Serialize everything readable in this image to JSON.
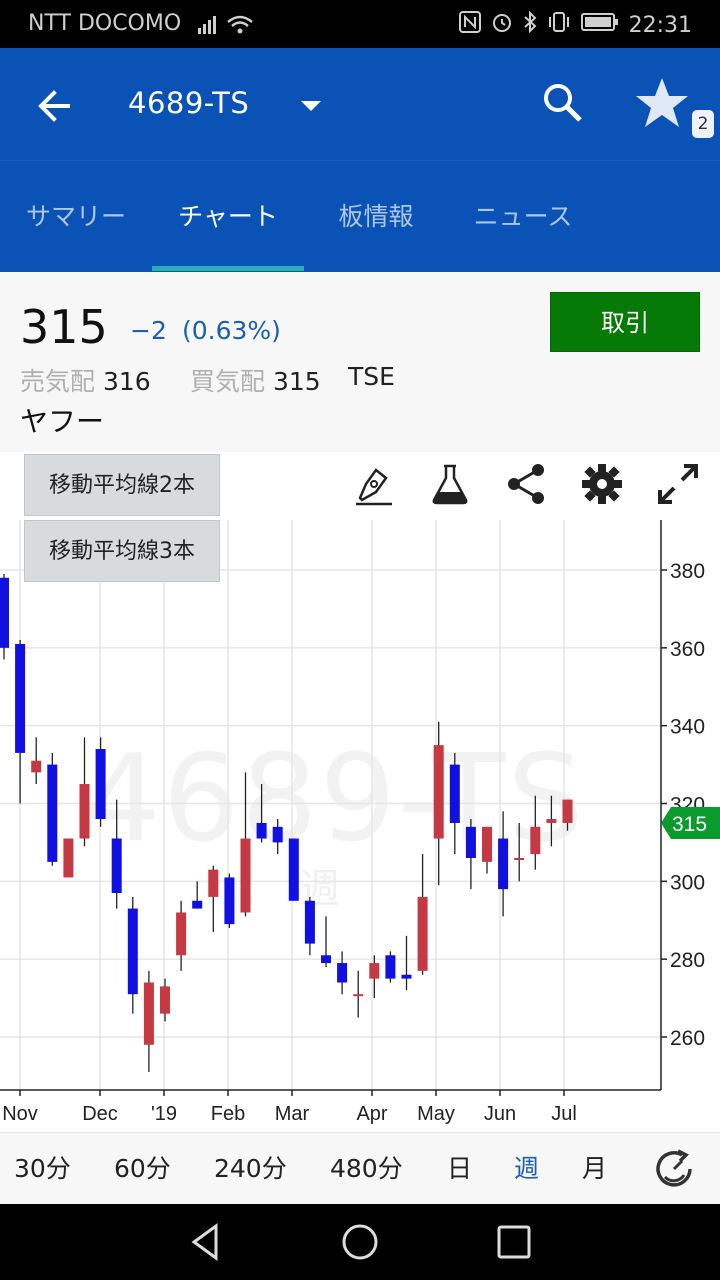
{
  "status": {
    "carrier": "NTT DOCOMO",
    "time": "22:31"
  },
  "appbar": {
    "title": "4689-TS",
    "favorites_badge": "2"
  },
  "tabs": [
    "サマリー",
    "チャート",
    "板情報",
    "ニュース"
  ],
  "active_tab": "チャート",
  "quote": {
    "price": "315",
    "change": "−2",
    "change_pct": "(0.63%)",
    "ask_label": "売気配",
    "ask_value": "316",
    "bid_label": "買気配",
    "bid_value": "315",
    "exchange": "TSE",
    "company": "ヤフー",
    "trade_label": "取引"
  },
  "chart_controls": {
    "ma2_label": "移動平均線2本",
    "ma3_label": "移動平均線3本",
    "icons": [
      "draw-pen-icon",
      "flask-icon",
      "share-icon",
      "settings-gear-icon",
      "fullscreen-icon"
    ]
  },
  "watermark": {
    "ticker": "4689-TS",
    "interval": "週"
  },
  "periods": [
    "30分",
    "60分",
    "240分",
    "480分",
    "日",
    "週",
    "月"
  ],
  "active_period": "週",
  "colors": {
    "primary": "#0a52b5",
    "up": "#c43a44",
    "down": "#1010e0",
    "trade": "#067a07",
    "last_price_tag": "#0a9a2e",
    "tab_indicator": "#27b3b0"
  },
  "chart_data": {
    "type": "candlestick",
    "x_labels": [
      "Nov",
      "Dec",
      "'19",
      "Feb",
      "Mar",
      "Apr",
      "May",
      "Jun",
      "Jul"
    ],
    "y_ticks": [
      260,
      280,
      300,
      320,
      340,
      360,
      380
    ],
    "ylim": [
      247,
      390
    ],
    "last_price": 315,
    "candles": [
      {
        "o": 378,
        "h": 379,
        "l": 357,
        "c": 360
      },
      {
        "o": 361,
        "h": 362,
        "l": 320,
        "c": 333
      },
      {
        "o": 328,
        "h": 337,
        "l": 325,
        "c": 331
      },
      {
        "o": 330,
        "h": 333,
        "l": 304,
        "c": 305
      },
      {
        "o": 301,
        "h": 311,
        "l": 301,
        "c": 311
      },
      {
        "o": 311,
        "h": 337,
        "l": 309,
        "c": 325
      },
      {
        "o": 334,
        "h": 337,
        "l": 314,
        "c": 316
      },
      {
        "o": 311,
        "h": 321,
        "l": 293,
        "c": 297
      },
      {
        "o": 293,
        "h": 296,
        "l": 266,
        "c": 271
      },
      {
        "o": 258,
        "h": 277,
        "l": 251,
        "c": 274
      },
      {
        "o": 266,
        "h": 275,
        "l": 264,
        "c": 273
      },
      {
        "o": 281,
        "h": 295,
        "l": 277,
        "c": 292
      },
      {
        "o": 295,
        "h": 300,
        "l": 293,
        "c": 293
      },
      {
        "o": 296,
        "h": 304,
        "l": 287,
        "c": 303
      },
      {
        "o": 301,
        "h": 302,
        "l": 288,
        "c": 289
      },
      {
        "o": 292,
        "h": 328,
        "l": 291,
        "c": 311
      },
      {
        "o": 315,
        "h": 325,
        "l": 310,
        "c": 311
      },
      {
        "o": 314,
        "h": 316,
        "l": 307,
        "c": 310
      },
      {
        "o": 311,
        "h": 311,
        "l": 295,
        "c": 295
      },
      {
        "o": 295,
        "h": 296,
        "l": 281,
        "c": 284
      },
      {
        "o": 281,
        "h": 291,
        "l": 278,
        "c": 279
      },
      {
        "o": 279,
        "h": 282,
        "l": 271,
        "c": 274
      },
      {
        "o": 271,
        "h": 277,
        "l": 265,
        "c": 271
      },
      {
        "o": 275,
        "h": 281,
        "l": 270,
        "c": 279
      },
      {
        "o": 281,
        "h": 282,
        "l": 274,
        "c": 275
      },
      {
        "o": 276,
        "h": 286,
        "l": 272,
        "c": 275
      },
      {
        "o": 277,
        "h": 307,
        "l": 276,
        "c": 296
      },
      {
        "o": 311,
        "h": 341,
        "l": 299,
        "c": 335
      },
      {
        "o": 330,
        "h": 333,
        "l": 307,
        "c": 315
      },
      {
        "o": 314,
        "h": 316,
        "l": 298,
        "c": 306
      },
      {
        "o": 305,
        "h": 314,
        "l": 302,
        "c": 314
      },
      {
        "o": 311,
        "h": 318,
        "l": 291,
        "c": 298
      },
      {
        "o": 306,
        "h": 315,
        "l": 300,
        "c": 306
      },
      {
        "o": 307,
        "h": 322,
        "l": 303,
        "c": 314
      },
      {
        "o": 315,
        "h": 322,
        "l": 309,
        "c": 316
      },
      {
        "o": 315,
        "h": 321,
        "l": 313,
        "c": 321
      }
    ]
  }
}
